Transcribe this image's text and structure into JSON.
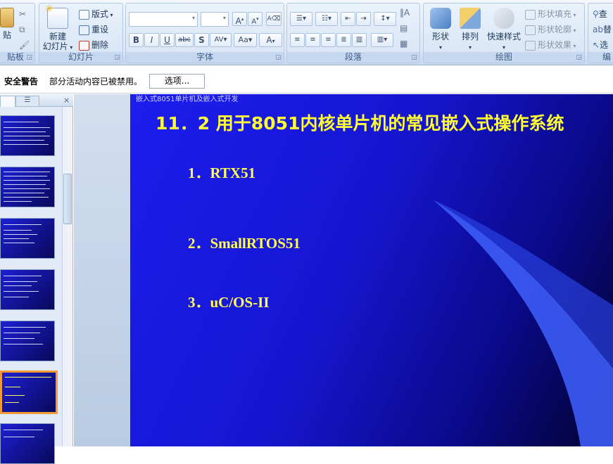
{
  "ribbon": {
    "clipboard": {
      "paste": "贴",
      "label": "贴板"
    },
    "slides": {
      "new_slide": "新建",
      "new_slide_2": "幻灯片",
      "layout": "版式",
      "reset": "重设",
      "delete": "删除",
      "label": "幻灯片"
    },
    "font": {
      "label": "字体"
    },
    "paragraph": {
      "label": "段落"
    },
    "drawing": {
      "shapes": "形状",
      "arrange": "排列",
      "quick_styles": "快速样式",
      "shape_fill": "形状填充",
      "shape_outline": "形状轮廓",
      "shape_effects": "形状效果",
      "label": "绘图"
    },
    "editing": {
      "find": "查",
      "replace": "替",
      "select": "选",
      "label": "编"
    }
  },
  "security": {
    "title": "安全警告",
    "message": "部分活动内容已被禁用。",
    "options_button": "选项..."
  },
  "slide": {
    "header": "嵌入式8051单片机及嵌入式开发",
    "title": "11．2  用于8051内核单片机的常见嵌入式操作系统",
    "items": [
      "1．RTX51",
      "2．SmallRTOS51",
      "3．uC/OS-II"
    ]
  },
  "colors": {
    "slide_bg": "#1616d0",
    "title_text": "#ffff33",
    "selected_thumb_border": "#f29a36"
  }
}
